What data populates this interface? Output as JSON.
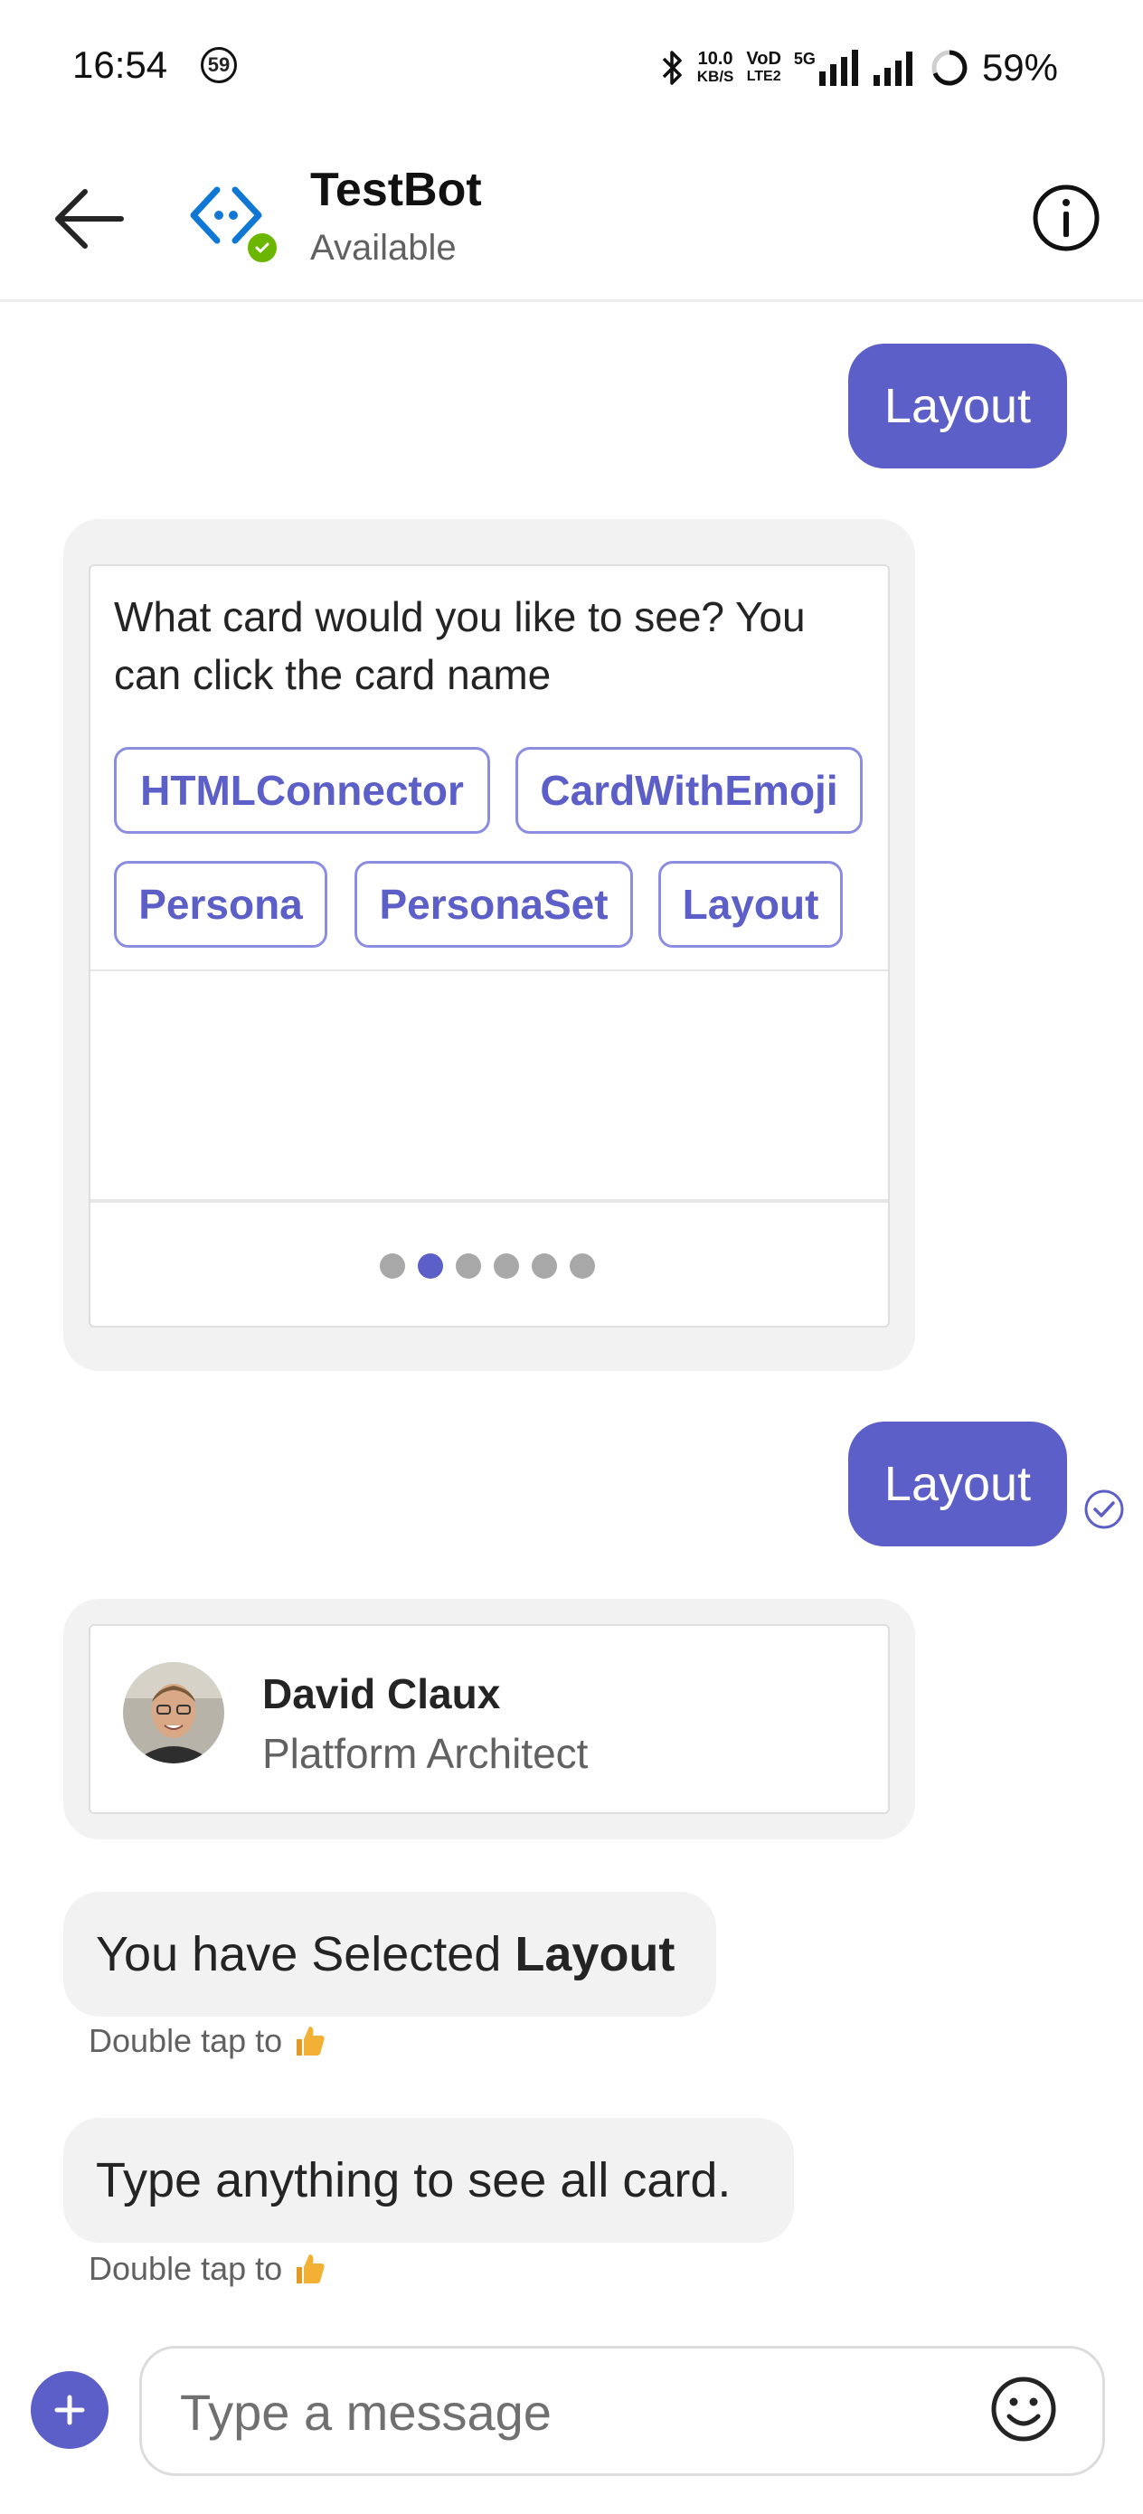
{
  "status_bar": {
    "time": "16:54",
    "notification_count": "59",
    "net_speed_value": "10.0",
    "net_speed_unit": "KB/S",
    "volte_top": "VoD",
    "volte_bottom": "LTE2",
    "network": "5G",
    "battery": "59%"
  },
  "header": {
    "bot_name": "TestBot",
    "presence": "Available"
  },
  "messages": {
    "out1": "Layout",
    "card1": {
      "prompt": "What card would you like to see? You can click the card name",
      "chips": [
        "HTMLConnector",
        "CardWithEmoji",
        "Persona",
        "PersonaSet",
        "Layout"
      ],
      "carousel_total": 6,
      "carousel_active_index": 1
    },
    "out2": "Layout",
    "persona": {
      "name": "David Claux",
      "title": "Platform Architect"
    },
    "in1_prefix": "You have Selected ",
    "in1_bold": "Layout",
    "hint1": "Double tap to",
    "in2": "Type anything to see all card.",
    "hint2": "Double tap to"
  },
  "compose": {
    "placeholder": "Type a message"
  },
  "icons": [
    "back-arrow-icon",
    "bot-icon",
    "check-icon",
    "info-icon",
    "read-receipt-icon",
    "thumbs-up-icon",
    "plus-icon",
    "emoji-icon"
  ],
  "colors": {
    "accent": "#5b5fc7",
    "presence_available": "#6bb700",
    "bubble_incoming": "#f2f2f2",
    "thumbs": "#f2b134"
  }
}
